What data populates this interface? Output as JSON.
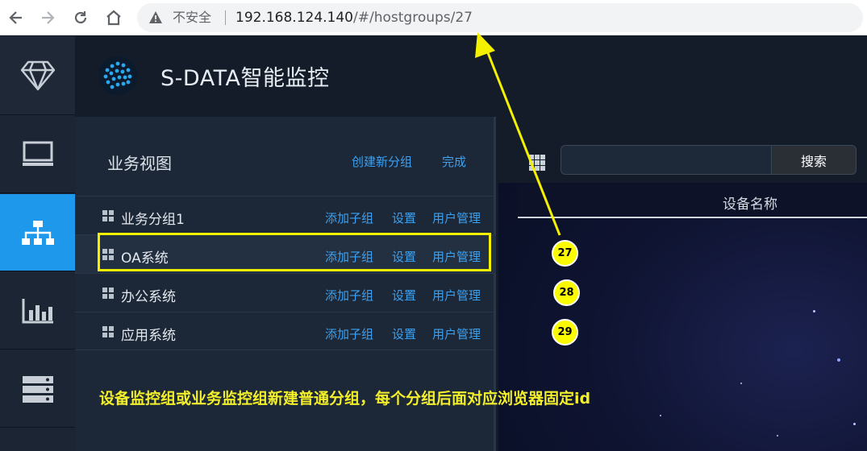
{
  "browser": {
    "insecure_label": "不安全",
    "url_host": "192.168.124.140",
    "url_path": "/#/hostgroups/27"
  },
  "app": {
    "title": "S-DATA智能监控"
  },
  "rail": {
    "items": [
      "logo-diamond-icon",
      "monitor-icon",
      "org-tree-icon",
      "bar-chart-icon",
      "server-icon"
    ],
    "active_index": 2
  },
  "tree": {
    "title": "业务视图",
    "create_group": "创建新分组",
    "done": "完成",
    "rows": [
      {
        "label": "业务分组1",
        "add_child": "添加子组",
        "settings": "设置",
        "user_mgmt": "用户管理"
      },
      {
        "label": "OA系统",
        "add_child": "添加子组",
        "settings": "设置",
        "user_mgmt": "用户管理"
      },
      {
        "label": "办公系统",
        "add_child": "添加子组",
        "settings": "设置",
        "user_mgmt": "用户管理"
      },
      {
        "label": "应用系统",
        "add_child": "添加子组",
        "settings": "设置",
        "user_mgmt": "用户管理"
      }
    ],
    "selected_index": 1
  },
  "right": {
    "search_value": "",
    "search_button": "搜索",
    "column_header": "设备名称"
  },
  "annotations": {
    "badges": [
      "27",
      "28",
      "29"
    ],
    "note": "设备监控组或业务监控组新建普通分组，每个分组后面对应浏览器固定id",
    "highlight_color": "#f4f000",
    "accent": "#1e98ea"
  }
}
